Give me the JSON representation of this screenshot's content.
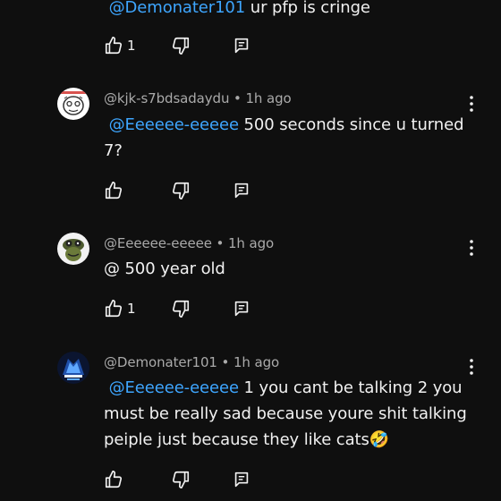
{
  "comments": [
    {
      "mention": "@Demonater101",
      "text": " ur pfp is cringe",
      "like_count": "1",
      "avatar_icon": "none"
    },
    {
      "author": "@kjk-s7bdsadaydu",
      "time": "1h ago",
      "mention": "@Eeeeee-eeeee",
      "text": " 500 seconds since u turned 7?",
      "like_count": "",
      "avatar_icon": "sketch-face-avatar-icon"
    },
    {
      "author": "@Eeeeee-eeeee",
      "time": "1h ago",
      "mention": "",
      "text": "@ 500 year old",
      "like_count": "1",
      "avatar_icon": "cartoon-frog-avatar-icon"
    },
    {
      "author": "@Demonater101",
      "time": "1h ago",
      "mention": "@Eeeeee-eeeee",
      "text": " 1 you cant be talking 2 you must be really sad because youre shit talking peiple just because they like cats🤣",
      "like_count": "",
      "avatar_icon": "gaming-logo-avatar-icon"
    }
  ],
  "colors": {
    "background": "#0f0f0f",
    "text": "#f1f1f1",
    "meta": "#aaaaaa",
    "mention": "#3ea6ff"
  }
}
